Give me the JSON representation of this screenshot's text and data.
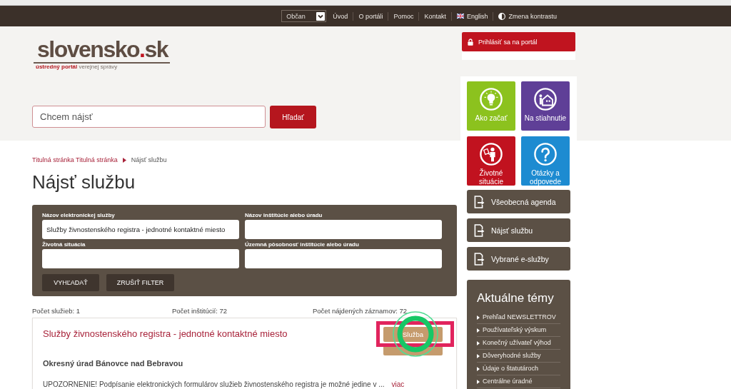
{
  "top_nav": {
    "audience_select": {
      "value": "Občan"
    },
    "links": [
      {
        "kind": "link",
        "label": "Úvod"
      },
      {
        "kind": "link",
        "label": "O portáli"
      },
      {
        "kind": "link",
        "label": "Pomoc"
      },
      {
        "kind": "link",
        "label": "Kontakt"
      },
      {
        "kind": "language",
        "label": "English"
      },
      {
        "kind": "contrast",
        "label": "Zmena kontrastu"
      }
    ]
  },
  "header": {
    "logo": {
      "name": "slovensko.sk",
      "tagline": "**ústredný portál** verejnej správy"
    },
    "search": {
      "placeholder": "Chcem nájsť",
      "button": "Hľadať"
    }
  },
  "breadcrumb": [
    {
      "kind": "link",
      "label": "Titulná stránka Titulná stránka"
    },
    {
      "kind": "current",
      "label": "Nájsť službu"
    }
  ],
  "page_title": "Nájsť službu",
  "filter": {
    "fields": [
      {
        "label": "Názov elektronickej služby",
        "value": "Služby živnostenského registra - jednotné kontaktné miesto"
      },
      {
        "label": "Názov inštitúcie alebo úradu"
      },
      {
        "label": "Životná situácia"
      },
      {
        "label": "Územná pôsobnosť inštitúcie alebo úradu"
      }
    ],
    "buttons": [
      {
        "label": "VYHĽADAŤ"
      },
      {
        "label": "ZRUŠIŤ FILTER"
      }
    ]
  },
  "summary": [
    "Počet služieb: 1",
    "Počet inštitúcií: 72",
    "Počet nájdených záznamov: 72"
  ],
  "results": [
    {
      "title": "Služby živnostenského registra - jednotné kontaktné miesto",
      "buttons": [
        {
          "kind": "labeled",
          "label": "Služba"
        },
        {
          "kind": "covered"
        }
      ],
      "institution": "Okresný úrad Bánovce nad Bebravou",
      "description": "UPOZORNENIE! Podpísanie elektronických formulárov služieb živnostenského registra je možné jedine v ...",
      "more_link": "viac"
    }
  ],
  "annotations": {
    "highlight_frame": true,
    "click_ring": true
  },
  "sidebar": {
    "login_button": "Prihlásiť sa na portál",
    "tiles": [
      {
        "label": "Ako začať",
        "color": "#8cc21e"
      },
      {
        "label": "Na stiahnutie",
        "color": "#5f3f97"
      },
      {
        "label": "Životné situácie",
        "color": "#c1121f"
      },
      {
        "label": "Otázky a odpovede",
        "color": "#1d8bd1"
      }
    ],
    "menu": [
      {
        "label": "Všeobecná agenda"
      },
      {
        "label": "Nájsť službu"
      },
      {
        "label": "Vybrané e-služby"
      }
    ],
    "topics": {
      "title": "Aktuálne témy",
      "items": [
        "Prehľad NEWSLETTROV",
        "Používateľský výskum",
        "Konečný užívateľ výhod",
        "Dôveryhodné služby",
        "Údaje o štatutároch",
        "Centrálne úradné"
      ]
    }
  }
}
